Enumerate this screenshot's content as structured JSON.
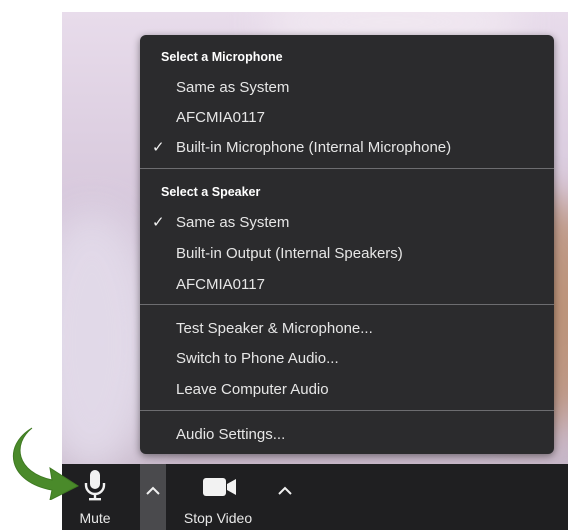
{
  "audio_menu": {
    "microphone_header": "Select a Microphone",
    "microphones": [
      {
        "label": "Same as System",
        "checked": false
      },
      {
        "label": "AFCMIA0117",
        "checked": false
      },
      {
        "label": "Built-in Microphone (Internal Microphone)",
        "checked": true
      }
    ],
    "speaker_header": "Select a Speaker",
    "speakers": [
      {
        "label": "Same as System",
        "checked": true
      },
      {
        "label": "Built-in Output (Internal Speakers)",
        "checked": false
      },
      {
        "label": "AFCMIA0117",
        "checked": false
      }
    ],
    "actions": [
      {
        "label": "Test Speaker & Microphone..."
      },
      {
        "label": "Switch to Phone Audio..."
      },
      {
        "label": "Leave Computer Audio"
      }
    ],
    "settings_label": "Audio Settings...",
    "check_glyph": "✓"
  },
  "toolbar": {
    "mute_label": "Mute",
    "stop_video_label": "Stop Video",
    "mute_icon": "microphone-icon",
    "video_icon": "video-camera-icon",
    "caret_icon": "chevron-up-icon"
  },
  "annotation": {
    "arrow_color": "#4a8a2a",
    "arrow_icon": "curved-arrow-icon"
  }
}
